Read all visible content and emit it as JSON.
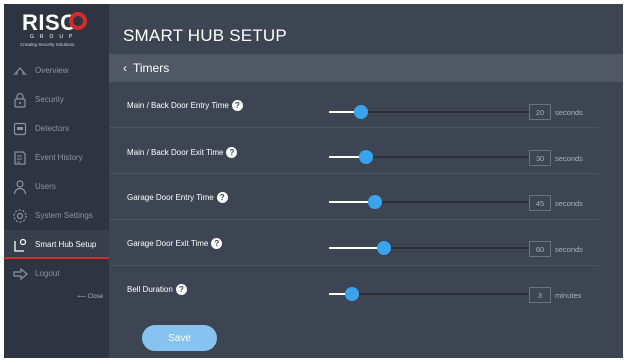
{
  "brand": {
    "logo": "RISC",
    "group": "GROUP",
    "tagline": "Creating Security Solutions."
  },
  "sidebar": {
    "items": [
      {
        "label": "Overview",
        "icon": "overview-icon",
        "active": false
      },
      {
        "label": "Security",
        "icon": "lock-icon",
        "active": false
      },
      {
        "label": "Detectors",
        "icon": "detector-icon",
        "active": false
      },
      {
        "label": "Event History",
        "icon": "history-icon",
        "active": false
      },
      {
        "label": "Users",
        "icon": "user-icon",
        "active": false
      },
      {
        "label": "System Settings",
        "icon": "gear-icon",
        "active": false
      },
      {
        "label": "Smart Hub Setup",
        "icon": "hub-setup-icon",
        "active": true
      },
      {
        "label": "Logout",
        "icon": "logout-icon",
        "active": false
      }
    ],
    "close_label": "⟵ Close"
  },
  "header": {
    "title": "SMART HUB SETUP"
  },
  "subheader": {
    "back_label": "Timers"
  },
  "timers": [
    {
      "label": "Main / Back Door Entry Time",
      "value": "20",
      "unit": "seconds",
      "fill": 0.1
    },
    {
      "label": "Main / Back Door Exit Time",
      "value": "30",
      "unit": "seconds",
      "fill": 0.13
    },
    {
      "label": "Garage Door Entry Time",
      "value": "45",
      "unit": "seconds",
      "fill": 0.18
    },
    {
      "label": "Garage Door Exit Time",
      "value": "60",
      "unit": "seconds",
      "fill": 0.23
    },
    {
      "label": "Bell Duration",
      "value": "3",
      "unit": "minutes",
      "fill": 0.05
    }
  ],
  "help_glyph": "?",
  "save_label": "Save",
  "colors": {
    "accent": "#3aa3ee",
    "brand_red": "#d62b2b",
    "save_button": "#86c3f0"
  }
}
